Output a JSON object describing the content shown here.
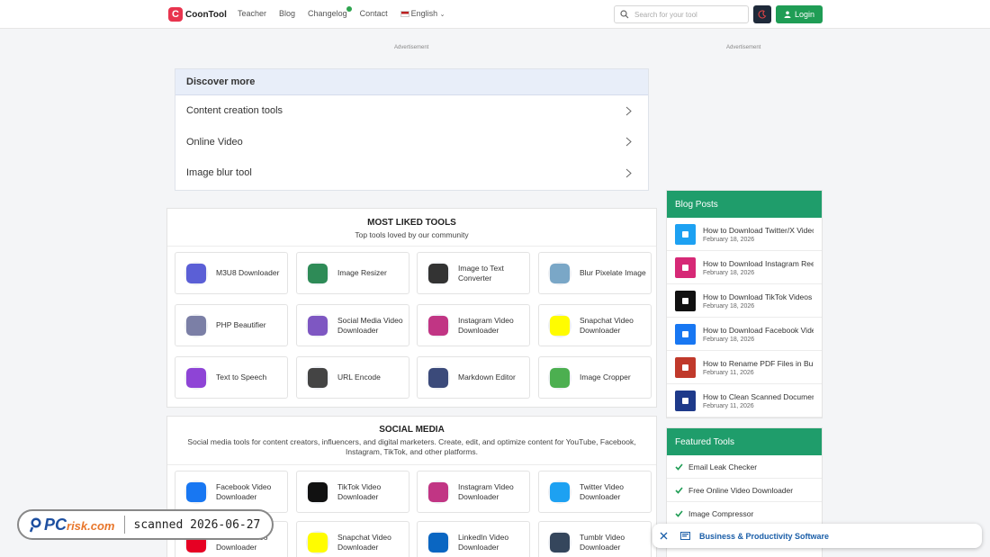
{
  "header": {
    "logo_text": "CoonTool",
    "nav": [
      "Teacher",
      "Blog",
      "Changelog",
      "Contact"
    ],
    "language": "English",
    "search_placeholder": "Search for your tool",
    "login_label": "Login"
  },
  "ads": {
    "label": "Advertisement"
  },
  "discover": {
    "title": "Discover more",
    "items": [
      "Content creation tools",
      "Online Video",
      "Image blur tool"
    ]
  },
  "most_liked": {
    "title": "MOST LIKED TOOLS",
    "subtitle": "Top tools loved by our community",
    "tools": [
      {
        "label": "M3U8 Downloader",
        "color": "#5b5fd6"
      },
      {
        "label": "Image Resizer",
        "color": "#2e8b57"
      },
      {
        "label": "Image to Text Converter",
        "color": "#333333"
      },
      {
        "label": "Blur Pixelate Image",
        "color": "#7aa7c7"
      },
      {
        "label": "PHP Beautifier",
        "color": "#7b7fa6"
      },
      {
        "label": "Social Media Video Downloader",
        "color": "#7e57c2"
      },
      {
        "label": "Instagram Video Downloader",
        "color": "#c13584"
      },
      {
        "label": "Snapchat Video Downloader",
        "color": "#fffc00"
      },
      {
        "label": "Text to Speech",
        "color": "#8e44d6"
      },
      {
        "label": "URL Encode",
        "color": "#444444"
      },
      {
        "label": "Markdown Editor",
        "color": "#3b4a7a"
      },
      {
        "label": "Image Cropper",
        "color": "#4caf50"
      }
    ]
  },
  "social_media": {
    "title": "SOCIAL MEDIA",
    "subtitle": "Social media tools for content creators, influencers, and digital marketers. Create, edit, and optimize content for YouTube, Facebook, Instagram, TikTok, and other platforms.",
    "tools": [
      {
        "label": "Facebook Video Downloader",
        "color": "#1877f2"
      },
      {
        "label": "TikTok Video Downloader",
        "color": "#111111"
      },
      {
        "label": "Instagram Video Downloader",
        "color": "#c13584"
      },
      {
        "label": "Twitter Video Downloader",
        "color": "#1da1f2"
      },
      {
        "label": "Pinterest Video Downloader",
        "color": "#e60023"
      },
      {
        "label": "Snapchat Video Downloader",
        "color": "#fffc00"
      },
      {
        "label": "LinkedIn Video Downloader",
        "color": "#0a66c2"
      },
      {
        "label": "Tumblr Video Downloader",
        "color": "#35465c"
      }
    ]
  },
  "blog": {
    "title": "Blog Posts",
    "posts": [
      {
        "title": "How to Download Twitter/X Videos",
        "date": "February 18, 2026",
        "color": "#1da1f2"
      },
      {
        "title": "How to Download Instagram Reels",
        "date": "February 18, 2026",
        "color": "#d62976"
      },
      {
        "title": "How to Download TikTok Videos",
        "date": "February 18, 2026",
        "color": "#111111"
      },
      {
        "title": "How to Download Facebook Videos",
        "date": "February 18, 2026",
        "color": "#1877f2"
      },
      {
        "title": "How to Rename PDF Files in Bulk",
        "date": "February 11, 2026",
        "color": "#c0392b"
      },
      {
        "title": "How to Clean Scanned Documents",
        "date": "February 11, 2026",
        "color": "#1e3a8a"
      }
    ]
  },
  "featured": {
    "title": "Featured Tools",
    "items": [
      "Email Leak Checker",
      "Free Online Video Downloader",
      "Image Compressor"
    ]
  },
  "notice": {
    "text": "Business & Productivity Software"
  },
  "watermark": {
    "brand_pc": "PC",
    "brand_risk": "risk.com",
    "scan_text": "scanned 2026-06-27"
  }
}
